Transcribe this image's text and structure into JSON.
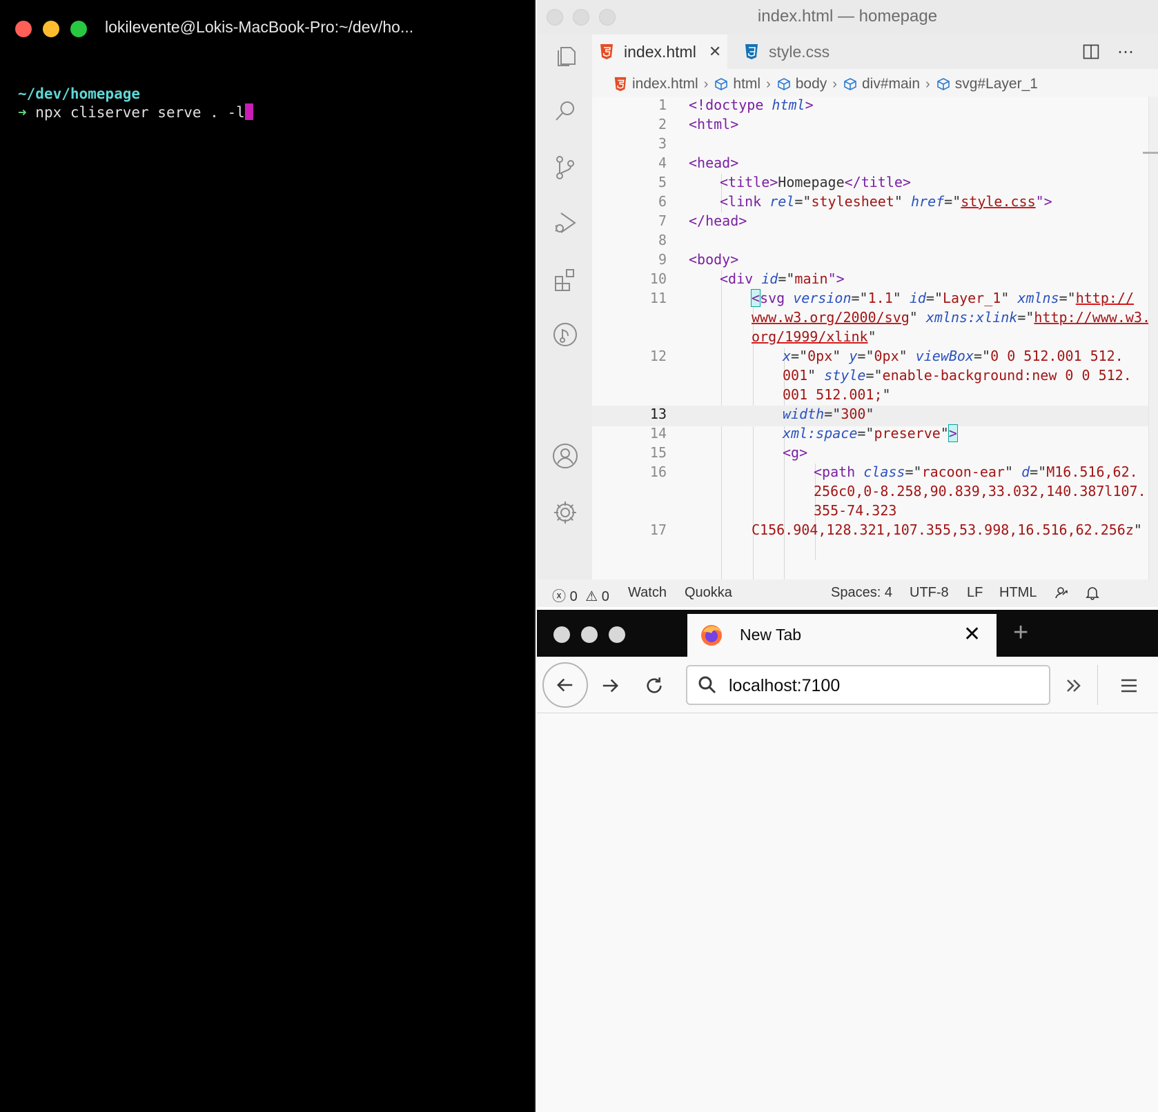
{
  "terminal": {
    "title": "lokilevente@Lokis-MacBook-Pro:~/dev/ho...",
    "prompt_dir": "~/dev/homepage",
    "prompt_symbol": "➜",
    "command": " npx cliserver serve . -l"
  },
  "vscode": {
    "window_title": "index.html — homepage",
    "tabs": [
      {
        "label": "index.html",
        "icon": "html5-icon",
        "active": true
      },
      {
        "label": "style.css",
        "icon": "css3-icon",
        "active": false
      }
    ],
    "breadcrumb": [
      "index.html",
      "html",
      "body",
      "div#main",
      "svg#Layer_1"
    ],
    "line_numbers": [
      "1",
      "2",
      "3",
      "4",
      "5",
      "6",
      "7",
      "8",
      "9",
      "10",
      "11",
      "12",
      "13",
      "14",
      "15",
      "16",
      "17"
    ],
    "current_line": "13",
    "status": {
      "errors": "0",
      "warnings": "0",
      "watch": "Watch",
      "quokka": "Quokka",
      "spaces": "Spaces: 4",
      "encoding": "UTF-8",
      "eol": "LF",
      "language": "HTML"
    },
    "code": {
      "l1_a": "<!doctype ",
      "l1_b": "html",
      "l1_c": ">",
      "l2": "<html>",
      "l4": "<head>",
      "l5_a": "<title>",
      "l5_b": "Homepage",
      "l5_c": "</title>",
      "l6_a": "<link ",
      "l6_b": "rel",
      "l6_c": "=\"",
      "l6_d": "stylesheet",
      "l6_e": "\" ",
      "l6_f": "href",
      "l6_g": "=\"",
      "l6_h": "style.css",
      "l6_i": "\">",
      "l7": "</head>",
      "l9": "<body>",
      "l10_a": "<div ",
      "l10_b": "id",
      "l10_c": "=\"",
      "l10_d": "main",
      "l10_e": "\">",
      "l11_a": "<",
      "l11_b": "svg ",
      "l11_c": "version",
      "l11_d": "=\"",
      "l11_e": "1.1",
      "l11_f": "\" ",
      "l11_g": "id",
      "l11_h": "=\"",
      "l11_i": "Layer_1",
      "l11_j": "\" ",
      "l11_k": "xmlns",
      "l11_l": "=\"",
      "l11_m": "http://",
      "l11w1_a": "www.w3.org/2000/svg",
      "l11w1_b": "\" ",
      "l11w1_c": "xmlns:xlink",
      "l11w1_d": "=\"",
      "l11w1_e": "http://www.w3.",
      "l11w2_a": "org/1999/xlink",
      "l11w2_b": "\"",
      "l12_a": "x",
      "l12_b": "=\"",
      "l12_c": "0px",
      "l12_d": "\" ",
      "l12_e": "y",
      "l12_f": "=\"",
      "l12_g": "0px",
      "l12_h": "\" ",
      "l12_i": "viewBox",
      "l12_j": "=\"",
      "l12_k": "0 0 512.001 512.",
      "l12w1_a": "001",
      "l12w1_b": "\" ",
      "l12w1_c": "style",
      "l12w1_d": "=\"",
      "l12w1_e": "enable-background:new 0 0 512.",
      "l12w2_a": "001 512.001;",
      "l12w2_b": "\"",
      "l13_a": "width",
      "l13_b": "=\"",
      "l13_c": "300",
      "l13_d": "\"",
      "l14_a": "xml:space",
      "l14_b": "=\"",
      "l14_c": "preserve",
      "l14_d": "\"",
      "l14_e": ">",
      "l15": "<g>",
      "l16_a": "<path ",
      "l16_b": "class",
      "l16_c": "=\"",
      "l16_d": "racoon-ear",
      "l16_e": "\" ",
      "l16_f": "d",
      "l16_g": "=\"",
      "l16_h": "M16.516,62.",
      "l16w1": "256c0,0-8.258,90.839,33.032,140.387l107.",
      "l16w2": "355-74.323",
      "l17_a": "C156.904,128.321,107.355,53.998,16.516,62.256z",
      "l17_b": "\""
    }
  },
  "firefox": {
    "tab_label": "New Tab",
    "url": "localhost:7100"
  }
}
